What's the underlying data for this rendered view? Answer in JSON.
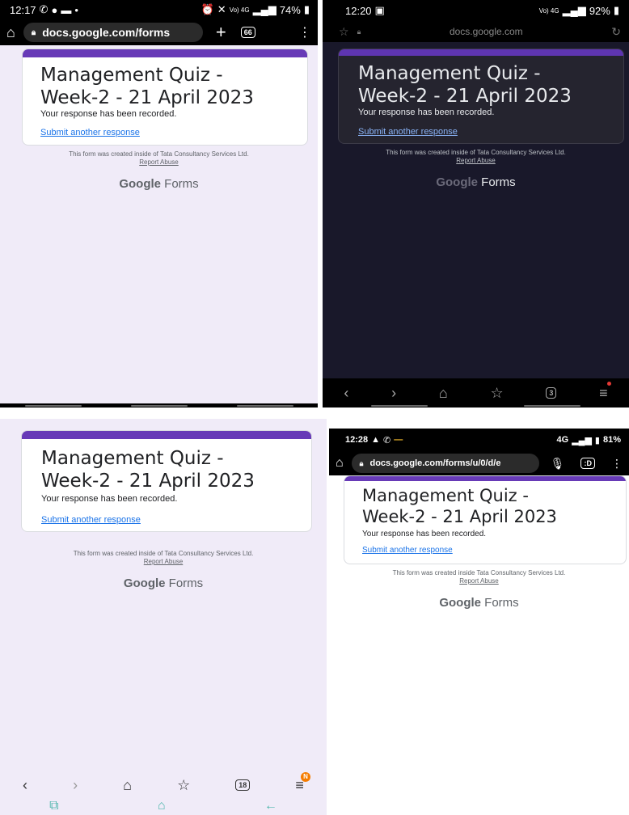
{
  "form": {
    "title_line1": "Management Quiz -",
    "title_line2": "Week-2 - 21 April 2023",
    "confirmation": "Your response has been recorded.",
    "submit_another": "Submit another response",
    "created_note": "This form was created inside of Tata Consultancy Services Ltd.",
    "created_note_alt": "This form was created inside Tata Consultancy Services Ltd.",
    "report_abuse": "Report Abuse",
    "brand_google": "Google",
    "brand_forms": "Forms"
  },
  "screenshot1": {
    "time": "12:17",
    "battery": "74%",
    "url": "docs.google.com/forms",
    "tab_count": "66",
    "status_icons": [
      "whatsapp-icon",
      "location-icon",
      "message-icon",
      "dot-icon"
    ],
    "network_text": "Vo) 4G"
  },
  "screenshot2": {
    "time": "12:20",
    "battery": "92%",
    "url": "docs.google.com",
    "tab_count": "3",
    "network_text": "Vo) 4G"
  },
  "screenshot3": {
    "tab_count": "18",
    "menu_badge": "N"
  },
  "screenshot4": {
    "time": "12:28",
    "battery": "81%",
    "url": "docs.google.com/forms/u/0/d/e",
    "network_text": "4G"
  },
  "colors": {
    "accent_purple": "#673ab7",
    "link_blue": "#1a73e8",
    "form_bg": "#f0ebf8",
    "dark_bg": "#19182a"
  }
}
